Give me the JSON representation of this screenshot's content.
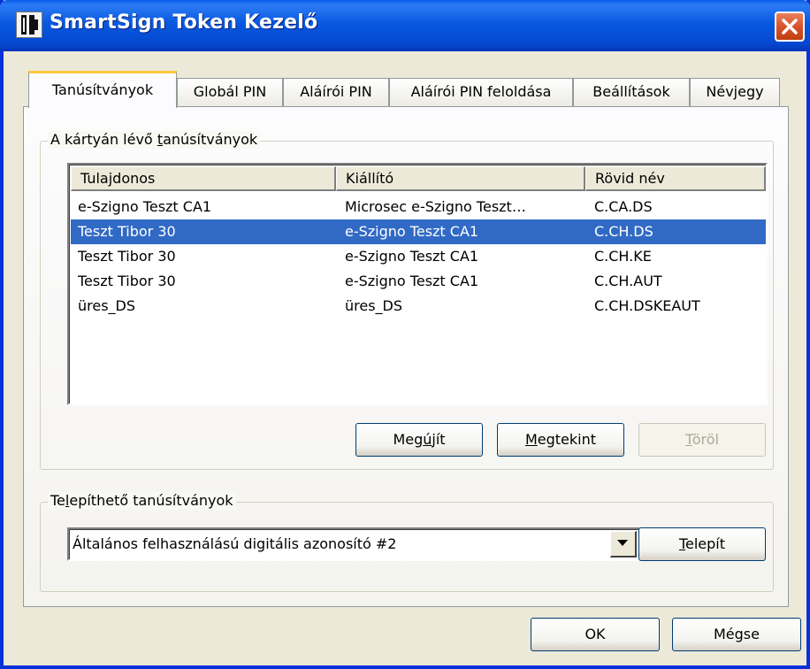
{
  "window": {
    "title": "SmartSign Token Kezelő"
  },
  "tabs": [
    {
      "label": "Tanúsítványok",
      "active": true
    },
    {
      "label": "Globál PIN"
    },
    {
      "label": "Aláírói PIN"
    },
    {
      "label": "Aláírói PIN feloldása"
    },
    {
      "label": "Beállítások"
    },
    {
      "label": "Névjegy"
    }
  ],
  "certificates_group": {
    "legend_pre": "A kártyán lévő ",
    "legend_accel": "t",
    "legend_post": "anúsítványok",
    "columns": [
      "Tulajdonos",
      "Kiállító",
      "Rövid név"
    ],
    "rows": [
      {
        "owner": "e-Szigno Teszt CA1",
        "issuer": "Microsec e-Szigno Teszt…",
        "short_name": "C.CA.DS"
      },
      {
        "owner": "Teszt Tibor 30",
        "issuer": "e-Szigno Teszt CA1",
        "short_name": "C.CH.DS",
        "selected": true
      },
      {
        "owner": "Teszt Tibor 30",
        "issuer": "e-Szigno Teszt CA1",
        "short_name": "C.CH.KE"
      },
      {
        "owner": "Teszt Tibor 30",
        "issuer": "e-Szigno Teszt CA1",
        "short_name": "C.CH.AUT"
      },
      {
        "owner": "üres_DS",
        "issuer": "üres_DS",
        "short_name": "C.CH.DSKEAUT"
      }
    ],
    "buttons": {
      "renew": {
        "pre": "Meg",
        "accel": "ú",
        "post": "jít"
      },
      "view": {
        "pre": "",
        "accel": "M",
        "post": "egtekint"
      },
      "delete": {
        "pre": "",
        "accel": "T",
        "post": "öröl"
      }
    }
  },
  "install_group": {
    "legend_pre": "Te",
    "legend_accel": "l",
    "legend_post": "epíthető tanúsítványok",
    "selected_value": "Általános felhasználású digitális azonosító #2",
    "install_button": {
      "pre": "",
      "accel": "T",
      "post": "elepít"
    }
  },
  "footer": {
    "ok_label": "OK",
    "cancel_label": "Mégse"
  },
  "colors": {
    "titlebar": "#0858e0",
    "selection": "#316ac5",
    "dialog_bg": "#ece9d8"
  }
}
